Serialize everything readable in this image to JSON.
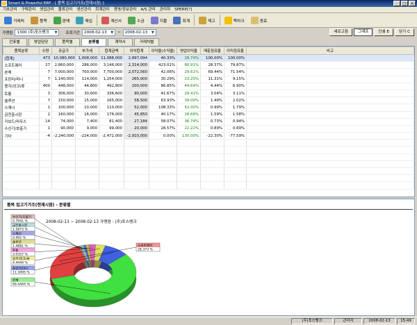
{
  "window": {
    "title": "Smart & Powerful ERP - [ 품목 입고기가조(현재시점) ]"
  },
  "menu": [
    "기초관리",
    "구매관리",
    "영업관리",
    "물류관리",
    "생산관리",
    "회계관리",
    "경영/정보관리",
    "A/S 관리",
    "관리자",
    "SPERP[?]"
  ],
  "toolbar": [
    {
      "label": "거래처",
      "icon": "users-icon",
      "color": "#3a7bd5"
    },
    {
      "label": "품목",
      "icon": "box-icon",
      "color": "#c8943a"
    },
    {
      "label": "판매",
      "icon": "cart-icon",
      "color": "#4aa34a"
    },
    {
      "label": "매입",
      "icon": "truck-icon",
      "color": "#3aa3b8"
    },
    {
      "label": "계산서",
      "icon": "invoice-icon",
      "color": "#d25a5a"
    },
    {
      "label": "수금",
      "icon": "money-in-icon",
      "color": "#55a855"
    },
    {
      "label": "지불",
      "icon": "money-out-icon",
      "color": "#7a7ad0"
    },
    {
      "label": "회계",
      "icon": "ledger-icon",
      "color": "#4b6fb8"
    },
    {
      "label": "재고",
      "icon": "warehouse-icon",
      "color": "#caa33a"
    },
    {
      "label": "북마크",
      "icon": "star-icon",
      "color": "#f2c20b"
    },
    {
      "label": "종료",
      "icon": "exit-icon",
      "color": "#d8c070"
    }
  ],
  "filters": {
    "branch_label": "가맹점",
    "branch_value": "1300 (주)포스뱅크",
    "period_label": "조회기간",
    "date_from": "2008-02-13",
    "date_to": "2008-02-13",
    "range_sep": "~"
  },
  "actions": {
    "refresh": "새로고침",
    "graph": "그래프",
    "print": "인쇄 E",
    "close": "닫기 C"
  },
  "tabs": [
    "전표별",
    "영업담당",
    "품목별",
    "분류별",
    "계약서",
    "거래처별"
  ],
  "active_tab": "분류별",
  "table": {
    "headers": [
      "품목분류",
      "수량",
      "공급가",
      "부가세",
      "합계금액",
      "이익합계",
      "이익율(수익율)",
      "영업이익율",
      "매출점유율",
      "이익점유율",
      "비고"
    ],
    "rows": [
      [
        "[합계]",
        "473",
        "10,080,000",
        "1,008,000",
        "11,088,000",
        "2,897,094",
        "40.33%",
        "28.74%",
        "100.00%",
        "100.00%",
        ""
      ],
      [
        "소프트웨어",
        "27",
        "2,860,000",
        "286,000",
        "3,146,000",
        "2,314,000",
        "423.01%",
        "80.91%",
        "28.37%",
        "79.87%",
        ""
      ],
      [
        "본체",
        "7",
        "7,000,000",
        "700,000",
        "7,700,000",
        "2,072,560",
        "42.06%",
        "29.61%",
        "69.44%",
        "71.54%",
        ""
      ],
      [
        "프린터/마니",
        "7",
        "1,140,000",
        "114,000",
        "1,254,000",
        "265,000",
        "30.29%",
        "23.25%",
        "11.31%",
        "9.15%",
        ""
      ],
      [
        "용지(잉크)류",
        "400",
        "448,000",
        "44,800",
        "492,800",
        "200,000",
        "86.85%",
        "44.64%",
        "4.44%",
        "6.90%",
        ""
      ],
      [
        "토통",
        "3",
        "306,000",
        "30,600",
        "336,600",
        "90,000",
        "41.67%",
        "29.41%",
        "3.04%",
        "3.11%",
        ""
      ],
      [
        "솔루션",
        "7",
        "150,000",
        "15,000",
        "165,000",
        "58,500",
        "63.93%",
        "39.00%",
        "1.49%",
        "2.02%",
        ""
      ],
      [
        "스캐너",
        "1",
        "100,000",
        "10,000",
        "110,000",
        "52,000",
        "108.33%",
        "52.00%",
        "0.99%",
        "1.79%",
        ""
      ],
      [
        "금전출시장",
        "2",
        "160,000",
        "16,000",
        "176,000",
        "45,850",
        "40.17%",
        "28.66%",
        "1.59%",
        "1.58%",
        ""
      ],
      [
        "키보드/마우스",
        "14",
        "74,000",
        "7,400",
        "81,400",
        "27,184",
        "58.07%",
        "36.74%",
        "0.73%",
        "0.94%",
        ""
      ],
      [
        "수신기/호출기",
        "1",
        "90,000",
        "9,000",
        "99,000",
        "20,000",
        "28.57%",
        "22.22%",
        "0.89%",
        "0.69%",
        ""
      ],
      [
        "기타",
        "-4",
        "-2,240,000",
        "-224,000",
        "-2,472,000",
        "-2,910,000",
        "0.00%",
        "130.00%",
        "-22.30%",
        "-77.59%",
        ""
      ]
    ]
  },
  "chart_panel": {
    "title": "품목 입고기가조(현재시점) - 분류별",
    "subtitle": "2008-02-13 ~ 2008-02-13   가맹점 : (주)포스뱅크"
  },
  "chart_data": {
    "type": "pie",
    "labels": [
      "수신기/호출기",
      "금전출시장",
      "스캐너",
      "솔루션",
      "토통",
      "용지(잉크)류",
      "프린터/마니",
      "본체",
      "소프트웨어"
    ],
    "values": [
      0.7941,
      1.5873,
      0.992,
      1.4881,
      3.0357,
      4.4444,
      11.3095,
      69.4444,
      28.373
    ],
    "display": [
      "0.7941 %",
      "1.5873 %",
      "0.992 %",
      "1.4881 %",
      "3.0357 %",
      "4.4444 %",
      "11.3095 %",
      "69.4444 %",
      "28.373 %"
    ],
    "colors": [
      "#c08080",
      "#80c0c0",
      "#6060d0",
      "#c0c040",
      "#e060c0",
      "#e0e060",
      "#4060e0",
      "#40e040",
      "#e04040"
    ],
    "legend_placement": "left"
  },
  "status": {
    "company": "(주)포스뱅크",
    "user": "관리자",
    "date": "2008-02-13",
    "time": "15:49"
  }
}
